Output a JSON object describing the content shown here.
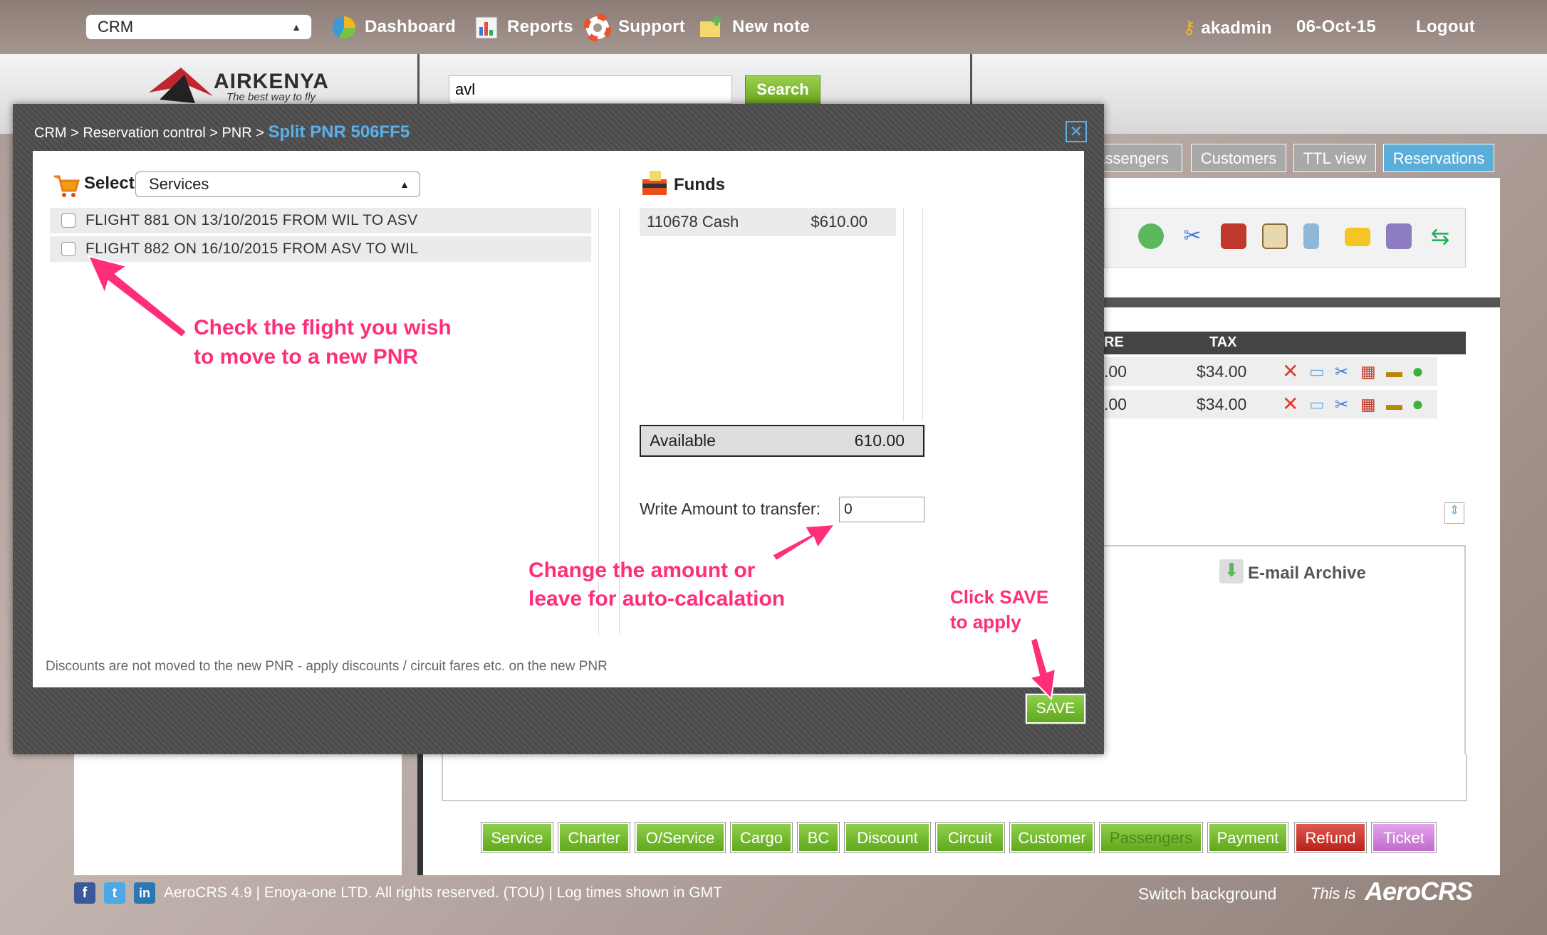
{
  "topnav": {
    "module_select": "CRM",
    "items": [
      {
        "label": "Dashboard",
        "icon": "pie-chart-icon"
      },
      {
        "label": "Reports",
        "icon": "bar-chart-icon"
      },
      {
        "label": "Support",
        "icon": "lifebuoy-icon"
      },
      {
        "label": "New note",
        "icon": "note-icon"
      }
    ],
    "user": "akadmin",
    "date": "06-Oct-15",
    "logout": "Logout"
  },
  "header": {
    "logo_text": "AIRKENYA",
    "logo_tagline": "The best way to fly",
    "search_value": "avl",
    "search_button": "Search"
  },
  "bg_tabs": [
    "assengers",
    "Customers",
    "TTL view",
    "Reservations"
  ],
  "bg_table": {
    "headers": [
      "RE",
      "TAX"
    ],
    "rows": [
      {
        "fare": ".00",
        "tax": "$34.00"
      },
      {
        "fare": ".00",
        "tax": "$34.00"
      }
    ]
  },
  "email_archive": "E-mail Archive",
  "bottom_buttons": [
    "Service",
    "Charter",
    "O/Service",
    "Cargo",
    "BC",
    "Discount",
    "Circuit",
    "Customer",
    "Passengers",
    "Payment",
    "Refund",
    "Ticket"
  ],
  "footer": {
    "text": "AeroCRS 4.9  | Enoya-one LTD. All rights reserved. (TOU)  | Log times shown in GMT",
    "switch_background": "Switch background",
    "this_is": "This is",
    "brand": "AeroCRS"
  },
  "modal": {
    "breadcrumb": "CRM > Reservation control > PNR > ",
    "breadcrumb_current": "Split PNR 506FF5",
    "select_label": "Select",
    "select_value": "Services",
    "flights": [
      "FLIGHT 881 ON 13/10/2015 FROM WIL TO ASV",
      "FLIGHT 882 ON 16/10/2015 FROM ASV TO WIL"
    ],
    "funds_title": "Funds",
    "funds": [
      {
        "name": "110678 Cash",
        "amount": "$610.00"
      }
    ],
    "available_label": "Available",
    "available_value": "610.00",
    "amount_label": "Write Amount to transfer:",
    "amount_value": "0",
    "note": "Discounts are not moved to the new PNR - apply discounts / circuit fares etc. on the new PNR",
    "save": "SAVE"
  },
  "annotations": {
    "a1_line1": "Check the flight you wish",
    "a1_line2": "to move to a new PNR",
    "a2_line1": "Change the amount or",
    "a2_line2": "leave for auto-calcalation",
    "a3_line1": "Click SAVE",
    "a3_line2": "to apply"
  },
  "colors": {
    "accent": "#5ab0e8",
    "annotation": "#ff2e7a",
    "button_green": "#6aa71e"
  }
}
